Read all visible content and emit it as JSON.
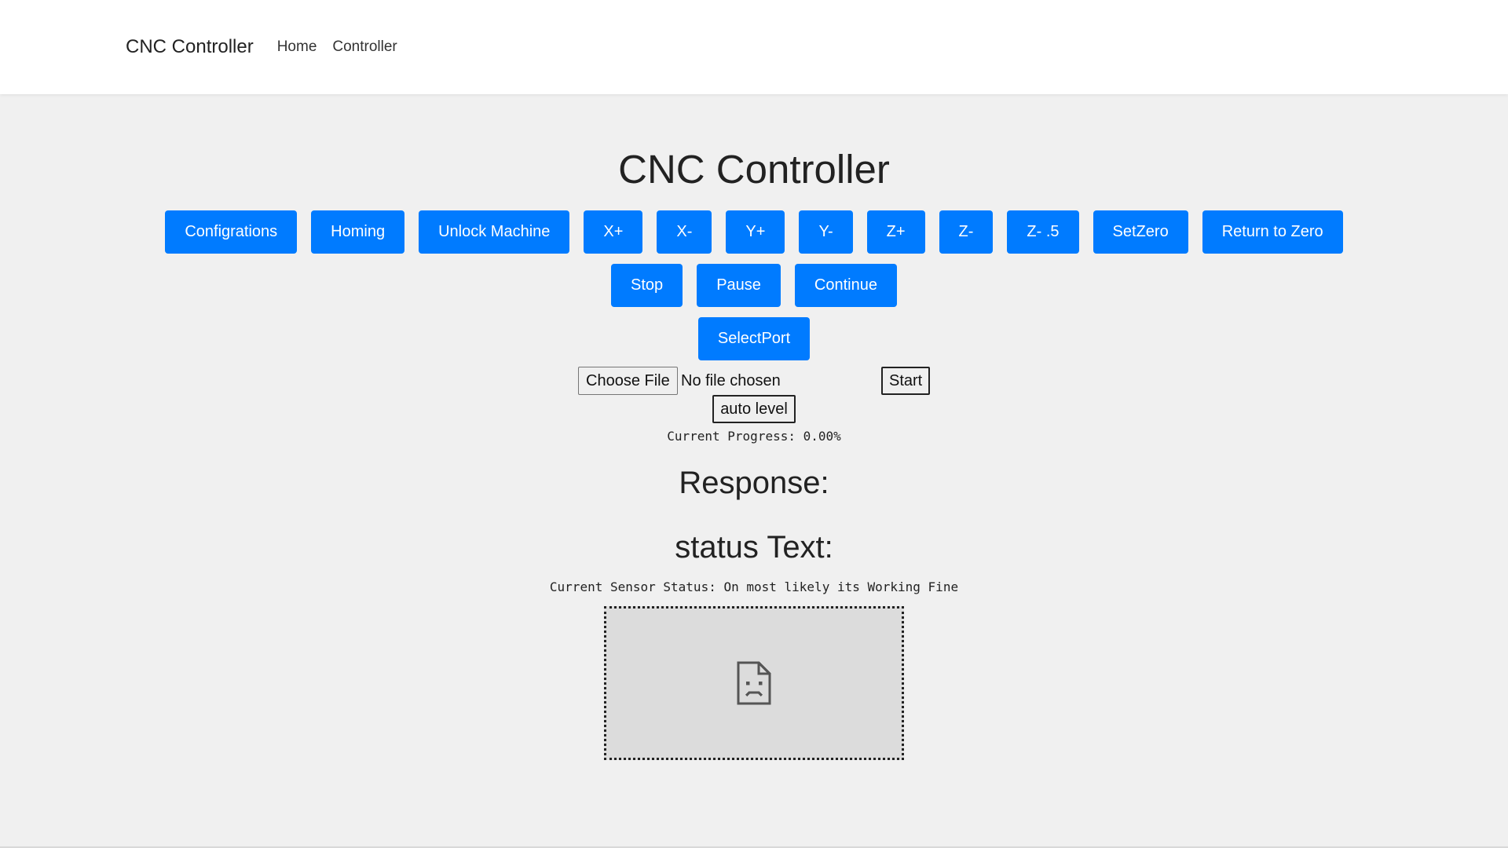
{
  "navbar": {
    "brand": "CNC Controller",
    "links": [
      "Home",
      "Controller"
    ]
  },
  "main": {
    "title": "CNC Controller",
    "button_rows": [
      [
        "Configrations",
        "Homing",
        "Unlock Machine",
        "X+",
        "X-",
        "Y+",
        "Y-",
        "Z+",
        "Z-",
        "Z- .5",
        "SetZero",
        "Return to Zero"
      ],
      [
        "Stop",
        "Pause",
        "Continue"
      ],
      [
        "SelectPort"
      ]
    ],
    "file_input": {
      "button_label": "Choose File",
      "status": "No file chosen"
    },
    "start_label": "Start",
    "auto_level_label": "auto level",
    "progress_text": "Current Progress: 0.00%",
    "response_heading": "Response:",
    "status_heading": "status Text:",
    "sensor_text": "Current Sensor Status: On most likely its Working Fine",
    "broken_image_icon": "broken-image-icon"
  },
  "colors": {
    "primary": "#007bff",
    "page_background": "#f0f0f0",
    "navbar_background": "#ffffff",
    "image_placeholder": "#dcdcdc"
  }
}
